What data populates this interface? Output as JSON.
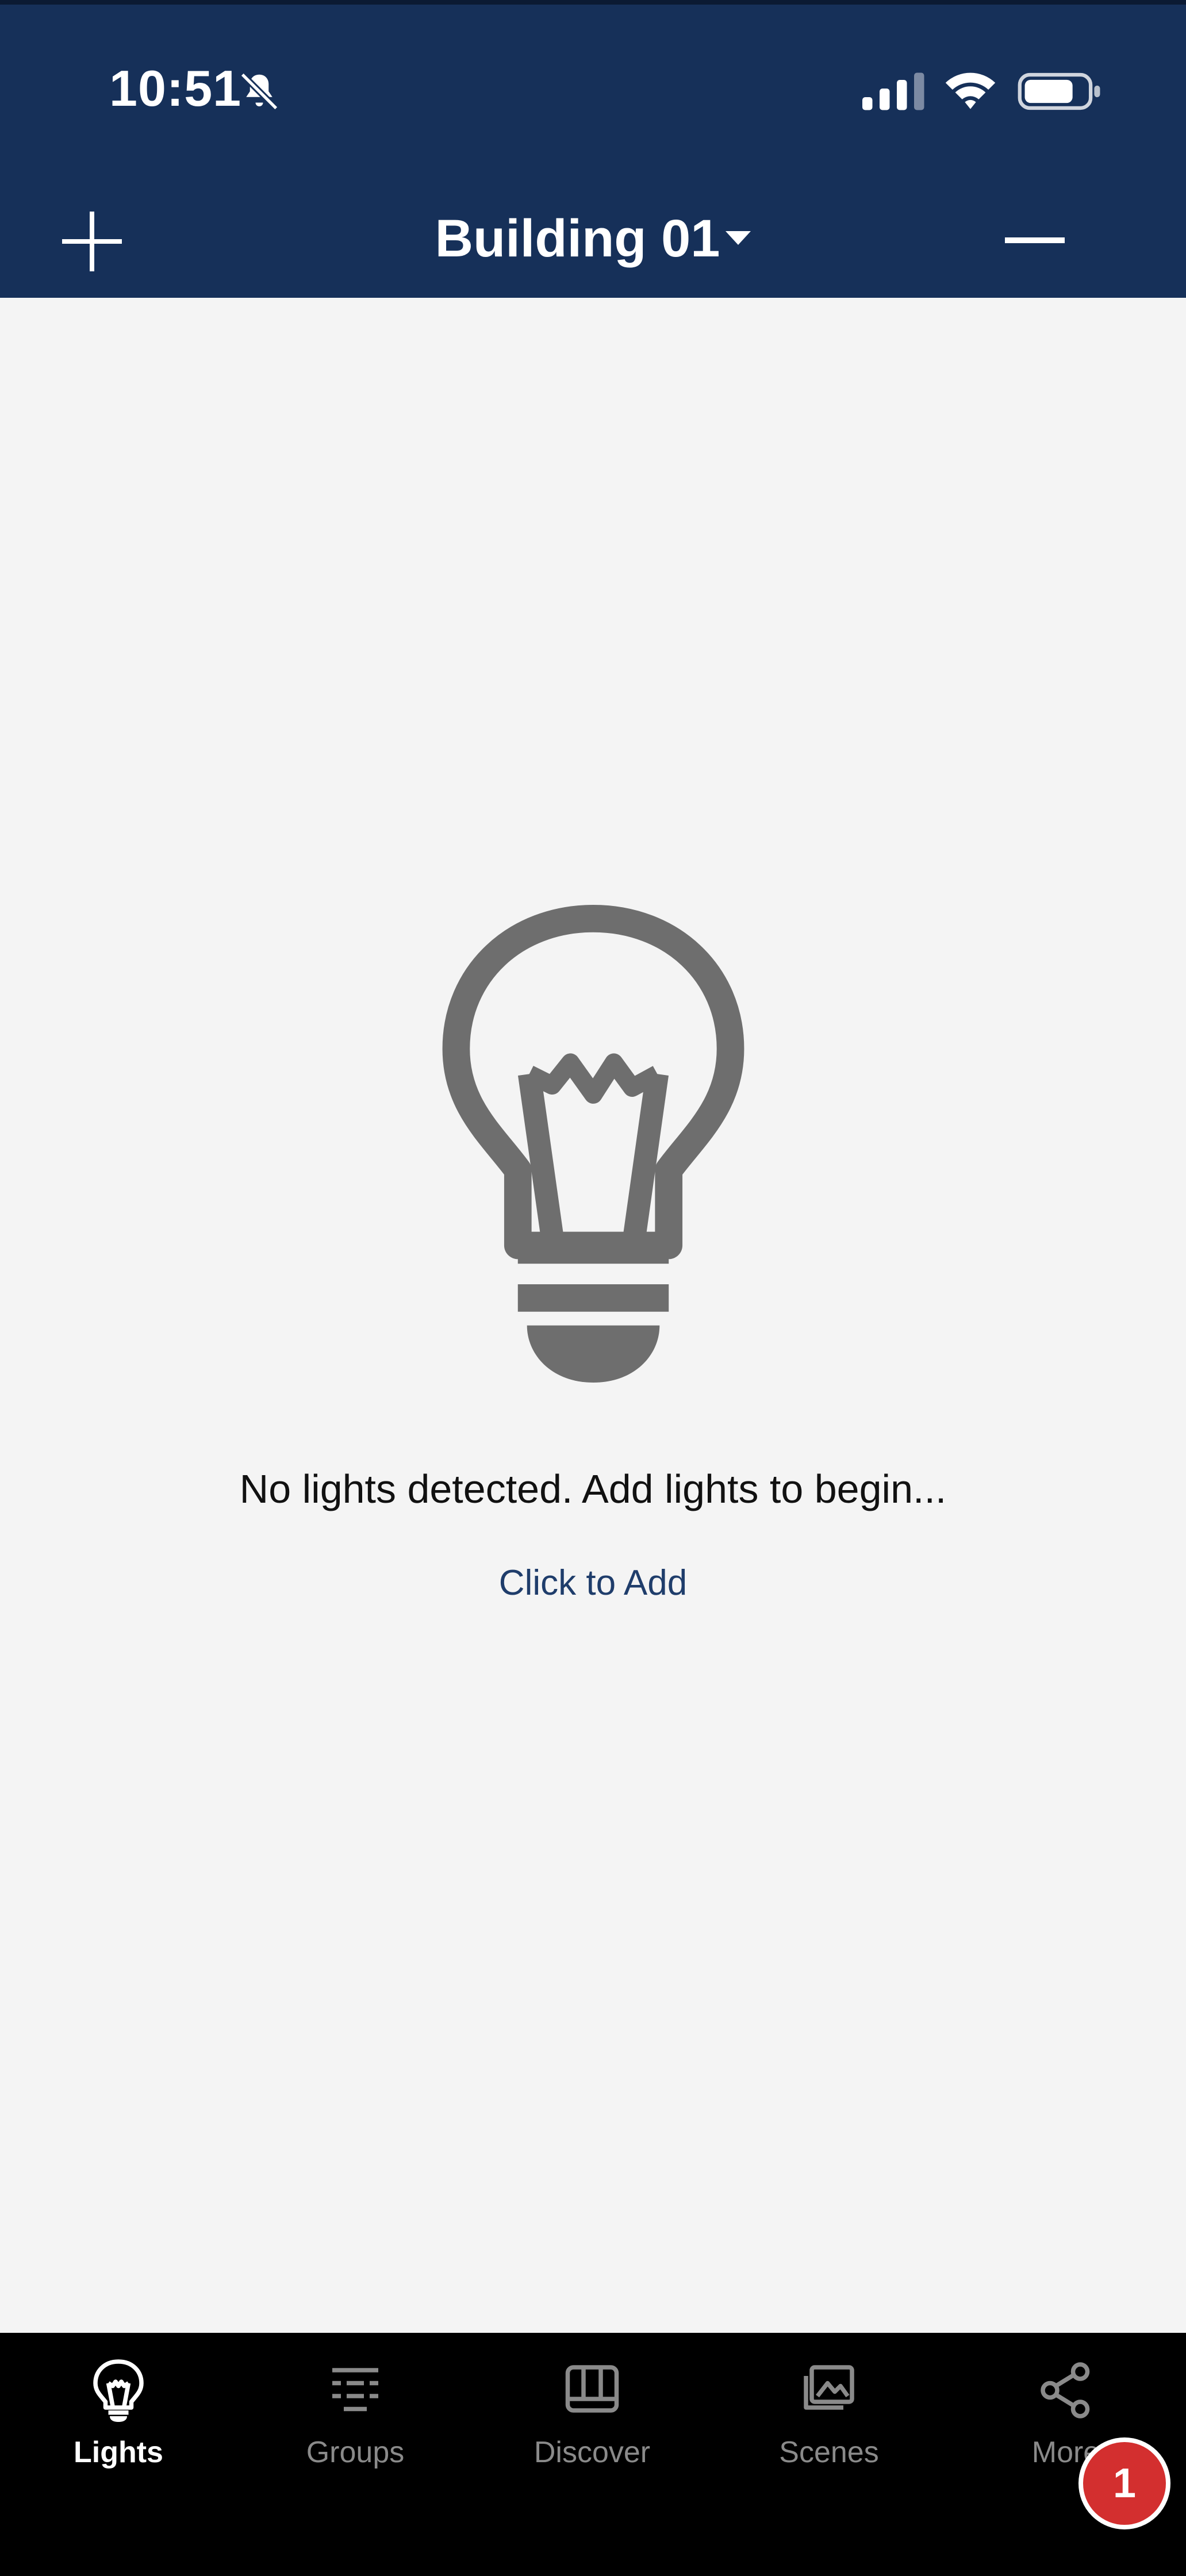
{
  "status_bar": {
    "time": "10:51",
    "icons": [
      "bell-off-icon",
      "cellular-signal-icon",
      "wifi-icon",
      "battery-icon"
    ]
  },
  "header": {
    "title": "Building 01",
    "add_icon": "plus-icon",
    "remove_icon": "minus-icon",
    "background": "#163059"
  },
  "empty_state": {
    "icon": "lightbulb-icon",
    "message": "No lights detected. Add lights to begin...",
    "action_label": "Click to Add"
  },
  "tab_bar": {
    "tabs": [
      {
        "label": "Lights",
        "icon": "lightbulb-icon",
        "active": true
      },
      {
        "label": "Groups",
        "icon": "groups-icon",
        "active": false
      },
      {
        "label": "Discover",
        "icon": "discover-icon",
        "active": false
      },
      {
        "label": "Scenes",
        "icon": "scenes-icon",
        "active": false
      },
      {
        "label": "More",
        "icon": "share-icon",
        "active": false
      }
    ],
    "badge": "1"
  },
  "colors": {
    "accent": "#163059",
    "link": "#1f3d6b",
    "badge": "#d32f2f",
    "background": "#f4f4f4"
  }
}
